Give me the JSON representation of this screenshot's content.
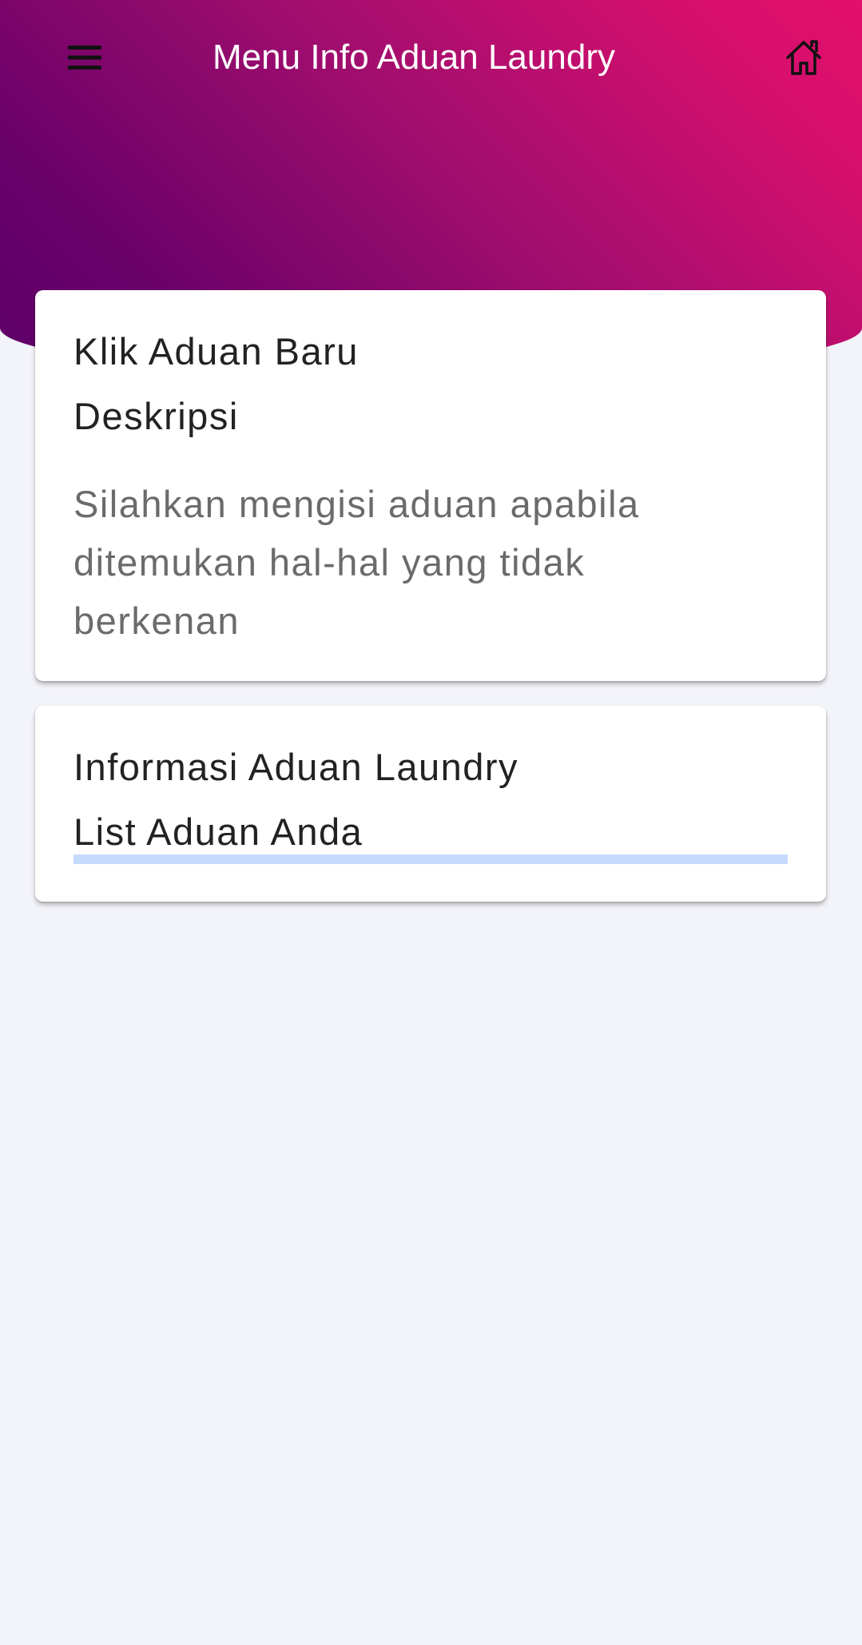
{
  "app_bar": {
    "title": "Menu Info Aduan Laundry",
    "menu_icon": "hamburger-menu-icon",
    "home_icon": "home-icon"
  },
  "colors": {
    "gradient_start": "#5e0068",
    "gradient_end": "#e20f6c",
    "background": "#f3f4f9",
    "progress_track": "#c6dafc"
  },
  "new_complaint_card": {
    "title": "Klik Aduan Baru",
    "subtitle": "Deskripsi",
    "description": "Silahkan mengisi aduan apabila ditemukan hal-hal yang tidak berkenan"
  },
  "complaint_info_card": {
    "title": "Informasi Aduan Laundry",
    "subtitle": "List Aduan Anda",
    "loading_progress": 0
  }
}
